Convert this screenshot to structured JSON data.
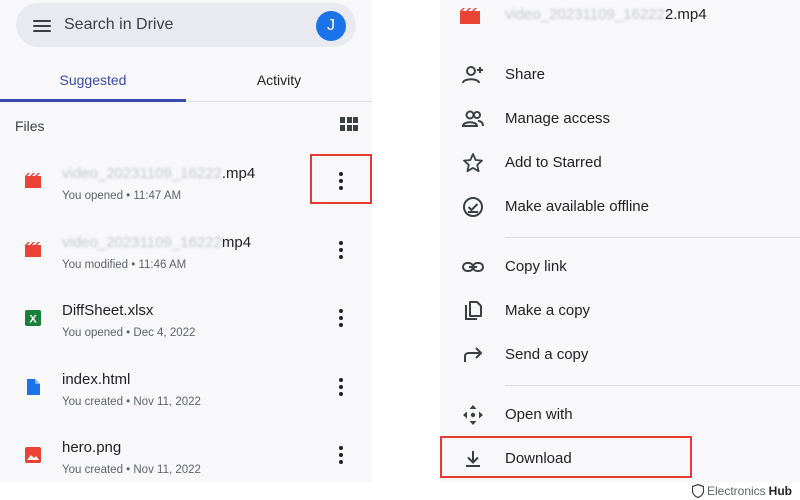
{
  "search": {
    "placeholder": "Search in Drive",
    "avatar_letter": "J"
  },
  "tabs": [
    {
      "label": "Suggested",
      "active": true
    },
    {
      "label": "Activity",
      "active": false
    }
  ],
  "files_section": {
    "label": "Files"
  },
  "files": [
    {
      "name_blurred": "video_20231109_16222",
      "name_suffix": ".mp4",
      "meta": "You opened • 11:47 AM",
      "icon": "video-file-icon"
    },
    {
      "name_blurred": "video_20231109_16222",
      "name_suffix": "mp4",
      "meta": "You modified • 11:46 AM",
      "icon": "video-file-icon"
    },
    {
      "name": "DiffSheet.xlsx",
      "meta": "You opened • Dec 4, 2022",
      "icon": "spreadsheet-file-icon"
    },
    {
      "name": "index.html",
      "meta": "You created • Nov 11, 2022",
      "icon": "document-file-icon"
    },
    {
      "name": "hero.png",
      "meta": "You created • Nov 11, 2022",
      "icon": "image-file-icon"
    }
  ],
  "menu": {
    "header": {
      "name_blurred": "video_202311",
      "name_suffix": "09_16222",
      "name_tail": "2.mp4"
    },
    "items": [
      {
        "label": "Share",
        "icon": "add-person-icon"
      },
      {
        "label": "Manage access",
        "icon": "people-icon"
      },
      {
        "label": "Add to Starred",
        "icon": "star-icon"
      },
      {
        "label": "Make available offline",
        "icon": "offline-check-icon"
      },
      {
        "label": "Copy link",
        "icon": "link-icon"
      },
      {
        "label": "Make a copy",
        "icon": "copy-icon"
      },
      {
        "label": "Send a copy",
        "icon": "send-arrow-icon"
      },
      {
        "label": "Open with",
        "icon": "move-arrows-icon"
      },
      {
        "label": "Download",
        "icon": "download-icon"
      }
    ]
  },
  "watermark": {
    "part1": "Electronics",
    "part2": "Hub"
  },
  "colors": {
    "accent": "#3949ab",
    "highlight": "#e53935",
    "avatar": "#1a73e8",
    "video": "#ea4335",
    "sheet": "#188038",
    "doc": "#1a73e8"
  }
}
